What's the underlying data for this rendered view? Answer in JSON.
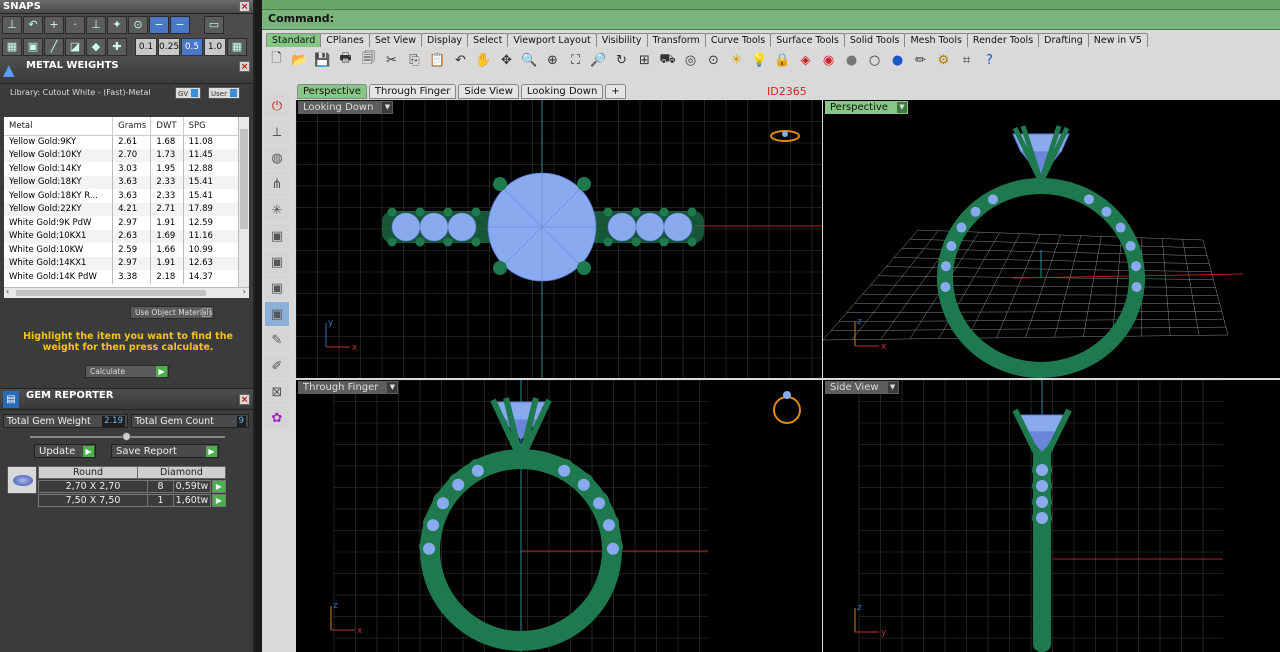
{
  "snaps": {
    "title": "SNAPS",
    "values": [
      "0.1",
      "0.25",
      "0.5",
      "1.0"
    ],
    "selected_value": "0.5"
  },
  "metal_weights": {
    "title": "METAL WEIGHTS",
    "library": "Library: Cutout White - (Fast)-Metal",
    "toggle_gv": "GV",
    "toggle_user": "User",
    "columns": [
      "Metal",
      "Grams",
      "DWT",
      "SPG"
    ],
    "rows": [
      [
        "Yellow Gold:9KY",
        "2.61",
        "1.68",
        "11.08"
      ],
      [
        "Yellow Gold:10KY",
        "2.70",
        "1.73",
        "11.45"
      ],
      [
        "Yellow Gold:14KY",
        "3.03",
        "1.95",
        "12.88"
      ],
      [
        "Yellow Gold:18KY",
        "3.63",
        "2.33",
        "15.41"
      ],
      [
        "Yellow Gold:18KY R...",
        "3.63",
        "2.33",
        "15.41"
      ],
      [
        "Yellow Gold:22KY",
        "4.21",
        "2.71",
        "17.89"
      ],
      [
        "White Gold:9K PdW",
        "2.97",
        "1.91",
        "12.59"
      ],
      [
        "White Gold:10KX1",
        "2.63",
        "1.69",
        "11.16"
      ],
      [
        "White Gold:10KW",
        "2.59",
        "1.66",
        "10.99"
      ],
      [
        "White Gold:14KX1",
        "2.97",
        "1.91",
        "12.63"
      ],
      [
        "White Gold:14K PdW",
        "3.38",
        "2.18",
        "14.37"
      ]
    ],
    "use_object_materials": "Use Object Materials",
    "instruction": "Highlight the item you want to find the weight for then press calculate.",
    "calculate": "Calculate"
  },
  "gem_reporter": {
    "title": "GEM REPORTER",
    "total_weight_label": "Total Gem Weight",
    "total_weight_value": "2.19",
    "total_count_label": "Total Gem Count",
    "total_count_value": "9",
    "update": "Update",
    "save_report": "Save Report",
    "shape": "Round",
    "stone": "Diamond",
    "rows": [
      {
        "size": "2,70 X 2,70",
        "count": "8",
        "weight": "0,59tw"
      },
      {
        "size": "7,50 X 7,50",
        "count": "1",
        "weight": "1,60tw"
      }
    ]
  },
  "command": {
    "label": "Command:"
  },
  "toolbar_tabs": [
    "Standard",
    "CPlanes",
    "Set View",
    "Display",
    "Select",
    "Viewport Layout",
    "Visibility",
    "Transform",
    "Curve Tools",
    "Surface Tools",
    "Solid Tools",
    "Mesh Tools",
    "Render Tools",
    "Drafting",
    "New in V5"
  ],
  "toolbar_icons": [
    "new-file",
    "open-folder",
    "save",
    "print",
    "page",
    "cut",
    "copy",
    "paste",
    "undo",
    "pan",
    "move",
    "zoom",
    "zoom-window",
    "zoom-extents",
    "zoom-selected",
    "rotate-view",
    "grid-layout",
    "car",
    "lens",
    "circle-target",
    "sun-rays",
    "bulb",
    "lock",
    "layer",
    "color-wheel",
    "gray-sphere",
    "white-sphere",
    "blue-sphere",
    "pencil",
    "gear",
    "snap-grid",
    "help"
  ],
  "viewport_tabs": [
    "Perspective",
    "Through Finger",
    "Side View",
    "Looking Down",
    "+"
  ],
  "model_id": "ID2365",
  "viewports": {
    "looking_down": "Looking Down",
    "perspective": "Perspective",
    "through_finger": "Through Finger",
    "side_view": "Side View"
  },
  "axis_labels": {
    "x": "x",
    "y": "y",
    "z": "z"
  },
  "colors": {
    "metal": "#1e7a4e",
    "gem": "#8aaaf0",
    "accent_green": "#86c786",
    "instruction_text": "#f5c21b",
    "id_text": "#e02020"
  }
}
